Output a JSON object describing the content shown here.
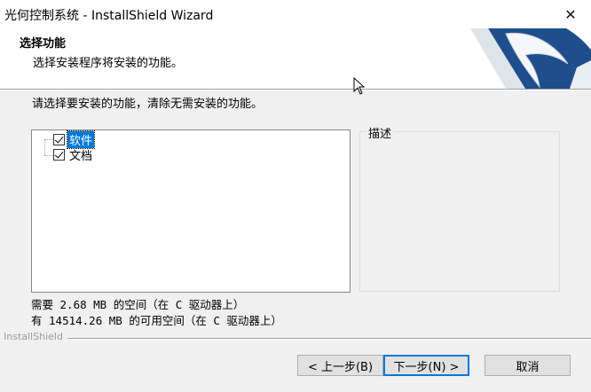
{
  "window": {
    "title": "光何控制系统 - InstallShield Wizard",
    "close_glyph": "✕"
  },
  "header": {
    "title": "选择功能",
    "subtitle": "选择安装程序将安装的功能。"
  },
  "main": {
    "instruction": "请选择要安装的功能，清除无需安装的功能。",
    "features": [
      {
        "label": "软件",
        "checked": true,
        "selected": true
      },
      {
        "label": "文档",
        "checked": true,
        "selected": false
      }
    ],
    "description_label": "描述",
    "space_required": "需要 2.68 MB 的空间（在 C 驱动器上）",
    "space_available": "有 14514.26 MB 的可用空间（在 C 驱动器上）"
  },
  "footer": {
    "brand": "InstallShield",
    "back_label": "< 上一步(B)",
    "next_label": "下一步(N) >",
    "cancel_label": "取消"
  },
  "colors": {
    "selection": "#0078d7",
    "logo_blue": "#1e4e8c"
  }
}
